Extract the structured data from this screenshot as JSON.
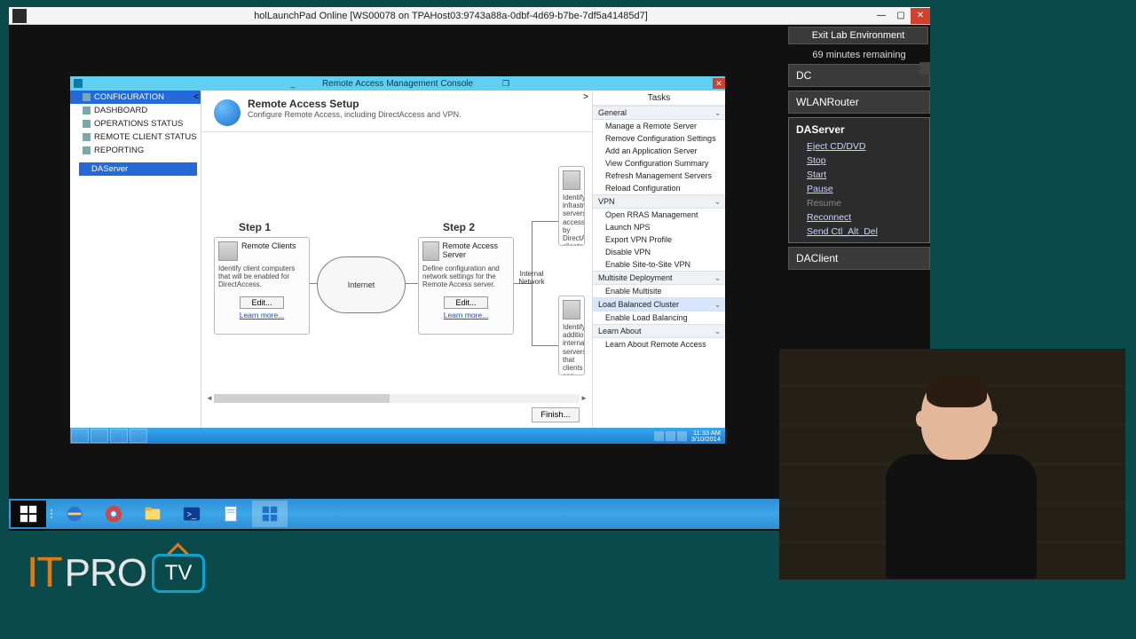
{
  "colors": {
    "accent": "#2f8ed3",
    "close": "#d0402e",
    "link": "#1850c8"
  },
  "outer": {
    "title": "holLaunchPad Online  [WS00078 on TPAHost03:9743a88a-0dbf-4d69-b7be-7df5a41485d7]",
    "min": "—",
    "max": "▢",
    "close": "✕"
  },
  "lab": {
    "exit_label": "Exit Lab Environment",
    "time_remaining": "69 minutes remaining",
    "machines": [
      {
        "name": "DC",
        "actions": []
      },
      {
        "name": "WLANRouter",
        "actions": []
      },
      {
        "name": "DAServer",
        "actions": [
          {
            "label": "Eject CD/DVD",
            "enabled": true
          },
          {
            "label": "Stop",
            "enabled": true
          },
          {
            "label": "Start",
            "enabled": true
          },
          {
            "label": "Pause",
            "enabled": true
          },
          {
            "label": "Resume",
            "enabled": false
          },
          {
            "label": "Reconnect",
            "enabled": true
          },
          {
            "label": "Send Ctl_Alt_Del",
            "enabled": true
          }
        ]
      },
      {
        "name": "DAClient",
        "actions": []
      }
    ]
  },
  "mmc": {
    "title": "Remote Access Management Console",
    "min": "_",
    "restore": "❐",
    "close": "✕",
    "nav": {
      "items": [
        {
          "label": "CONFIGURATION",
          "selected": true
        },
        {
          "label": "DASHBOARD",
          "selected": false
        },
        {
          "label": "OPERATIONS STATUS",
          "selected": false
        },
        {
          "label": "REMOTE CLIENT STATUS",
          "selected": false
        },
        {
          "label": "REPORTING",
          "selected": false
        }
      ],
      "server_item": "DAServer",
      "collapse": "<"
    },
    "hero": {
      "title": "Remote Access Setup",
      "subtitle": "Configure Remote Access, including DirectAccess and VPN.",
      "collapse": ">"
    },
    "steps": {
      "s1": {
        "label": "Step 1",
        "box_title": "Remote Clients",
        "box_desc": "Identify client computers that will be enabled for DirectAccess.",
        "edit": "Edit...",
        "learn": "Learn more..."
      },
      "cloud": "Internet",
      "s2": {
        "label": "Step 2",
        "box_title": "Remote Access Server",
        "box_desc": "Define configuration and network settings for the Remote Access server.",
        "edit": "Edit...",
        "learn": "Learn more..."
      },
      "net_label": "Internal Network",
      "s3": {
        "box_desc": "Identify infrastructure servers accessed by DirectAccess clients before connecting to internal resources."
      },
      "s4": {
        "box_desc": "Identify additional internal servers that clients can access end-to-end with DirectAccess."
      },
      "finish": "Finish..."
    },
    "tasks": {
      "header": "Tasks",
      "groups": [
        {
          "title": "General",
          "items": [
            "Manage a Remote Server",
            "Remove Configuration Settings",
            "Add an Application Server",
            "View Configuration Summary",
            "Refresh Management Servers",
            "Reload Configuration"
          ]
        },
        {
          "title": "VPN",
          "items": [
            "Open RRAS Management",
            "Launch NPS",
            "Export VPN Profile",
            "Disable VPN",
            "Enable Site-to-Site VPN"
          ]
        },
        {
          "title": "Multisite Deployment",
          "items": [
            "Enable Multisite"
          ]
        },
        {
          "title": "Load Balanced Cluster",
          "selected": true,
          "items": [
            "Enable Load Balancing"
          ]
        },
        {
          "title": "Learn About",
          "items": [
            "Learn About Remote Access"
          ]
        }
      ]
    }
  },
  "vm_taskbar": {
    "clock_time": "11:33 AM",
    "clock_date": "3/10/2014"
  },
  "logo": {
    "it": "IT",
    "pro": "PRO",
    "tv": "TV"
  }
}
